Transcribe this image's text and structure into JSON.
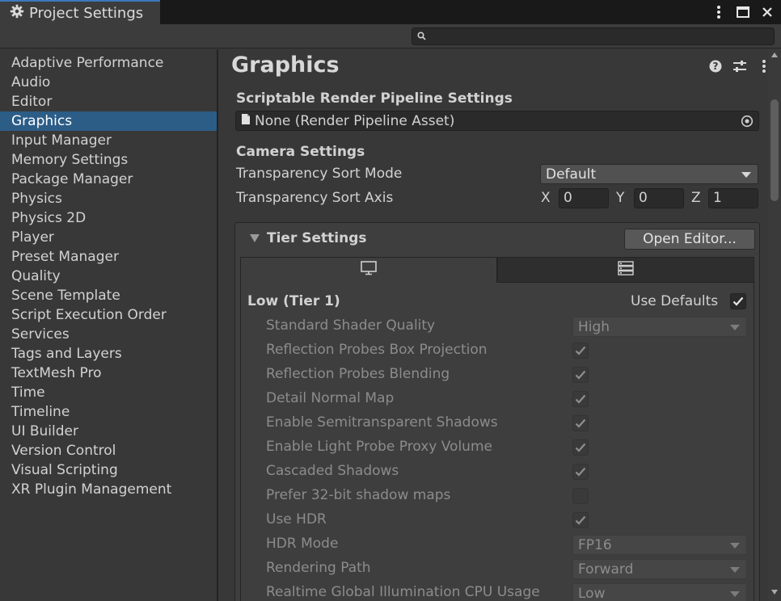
{
  "window": {
    "title": "Project Settings",
    "icons": [
      "gear-icon",
      "kebab-menu-icon",
      "maximize-icon",
      "close-icon"
    ]
  },
  "search": {
    "value": "",
    "placeholder": ""
  },
  "sidebar": {
    "items": [
      {
        "label": "Adaptive Performance"
      },
      {
        "label": "Audio"
      },
      {
        "label": "Editor"
      },
      {
        "label": "Graphics",
        "active": true
      },
      {
        "label": "Input Manager"
      },
      {
        "label": "Memory Settings"
      },
      {
        "label": "Package Manager"
      },
      {
        "label": "Physics"
      },
      {
        "label": "Physics 2D"
      },
      {
        "label": "Player"
      },
      {
        "label": "Preset Manager"
      },
      {
        "label": "Quality"
      },
      {
        "label": "Scene Template"
      },
      {
        "label": "Script Execution Order"
      },
      {
        "label": "Services"
      },
      {
        "label": "Tags and Layers"
      },
      {
        "label": "TextMesh Pro"
      },
      {
        "label": "Time"
      },
      {
        "label": "Timeline"
      },
      {
        "label": "UI Builder"
      },
      {
        "label": "Version Control"
      },
      {
        "label": "Visual Scripting"
      },
      {
        "label": "XR Plugin Management"
      }
    ]
  },
  "main": {
    "title": "Graphics",
    "srp": {
      "heading": "Scriptable Render Pipeline Settings",
      "value": "None (Render Pipeline Asset)"
    },
    "camera": {
      "heading": "Camera Settings",
      "sort_mode_label": "Transparency Sort Mode",
      "sort_mode_value": "Default",
      "sort_axis_label": "Transparency Sort Axis",
      "axis": {
        "x_label": "X",
        "x": "0",
        "y_label": "Y",
        "y": "0",
        "z_label": "Z",
        "z": "1"
      }
    },
    "tier": {
      "heading": "Tier Settings",
      "open_editor": "Open Editor...",
      "tier_title": "Low (Tier 1)",
      "use_defaults_label": "Use Defaults",
      "use_defaults": true,
      "rows": [
        {
          "label": "Standard Shader Quality",
          "type": "dropdown",
          "value": "High"
        },
        {
          "label": "Reflection Probes Box Projection",
          "type": "check",
          "checked": true
        },
        {
          "label": "Reflection Probes Blending",
          "type": "check",
          "checked": true
        },
        {
          "label": "Detail Normal Map",
          "type": "check",
          "checked": true
        },
        {
          "label": "Enable Semitransparent Shadows",
          "type": "check",
          "checked": true
        },
        {
          "label": "Enable Light Probe Proxy Volume",
          "type": "check",
          "checked": true
        },
        {
          "label": "Cascaded Shadows",
          "type": "check",
          "checked": true
        },
        {
          "label": "Prefer 32-bit shadow maps",
          "type": "check",
          "checked": false
        },
        {
          "label": "Use HDR",
          "type": "check",
          "checked": true
        },
        {
          "label": "HDR Mode",
          "type": "dropdown",
          "value": "FP16"
        },
        {
          "label": "Rendering Path",
          "type": "dropdown",
          "value": "Forward"
        },
        {
          "label": "Realtime Global Illumination CPU Usage",
          "type": "dropdown",
          "value": "Low"
        }
      ]
    }
  }
}
